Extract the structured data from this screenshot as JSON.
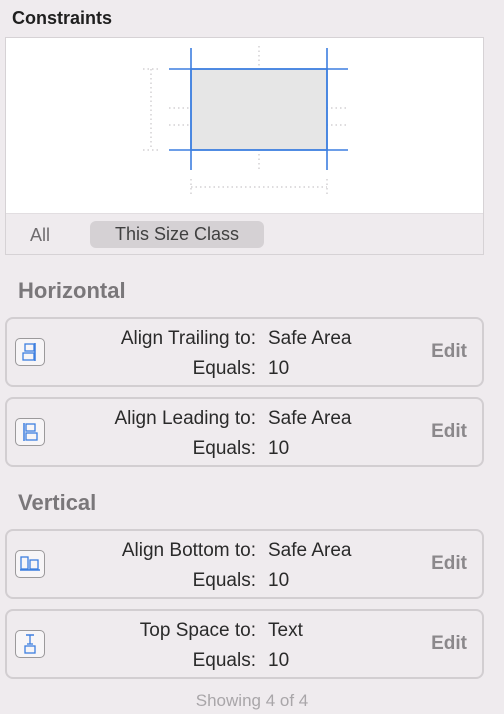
{
  "panel_title": "Constraints",
  "segments": {
    "all_label": "All",
    "size_class_label": "This Size Class",
    "selected": "This Size Class"
  },
  "groups": [
    {
      "title": "Horizontal",
      "constraints": [
        {
          "label": "Align Trailing to:",
          "target": "Safe Area",
          "equals_label": "Equals:",
          "equals_value": "10",
          "edit_label": "Edit",
          "icon": "align-trailing-icon"
        },
        {
          "label": "Align Leading to:",
          "target": "Safe Area",
          "equals_label": "Equals:",
          "equals_value": "10",
          "edit_label": "Edit",
          "icon": "align-leading-icon"
        }
      ]
    },
    {
      "title": "Vertical",
      "constraints": [
        {
          "label": "Align Bottom to:",
          "target": "Safe Area",
          "equals_label": "Equals:",
          "equals_value": "10",
          "edit_label": "Edit",
          "icon": "align-bottom-icon"
        },
        {
          "label": "Top Space to:",
          "target": "Text",
          "equals_label": "Equals:",
          "equals_value": "10",
          "edit_label": "Edit",
          "icon": "top-space-icon"
        }
      ]
    }
  ],
  "footer_text": "Showing 4 of 4",
  "colors": {
    "accent": "#3d7fe0",
    "panel_bg": "#efebee",
    "card_border": "#d2ced1"
  }
}
